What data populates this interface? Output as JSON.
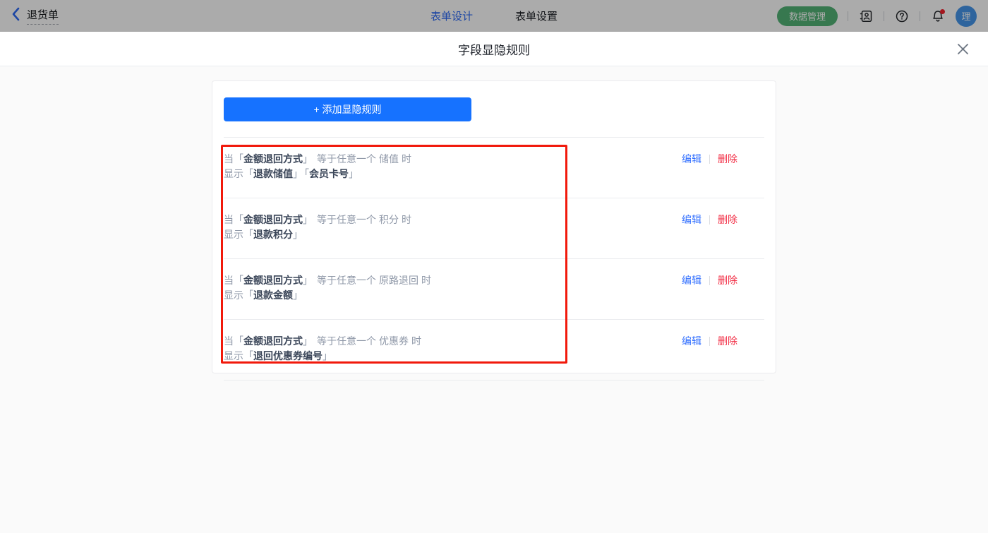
{
  "topbar": {
    "back_label": "退货单",
    "tabs": [
      {
        "label": "表单设计",
        "active": true
      },
      {
        "label": "表单设置",
        "active": false
      }
    ],
    "data_manage_label": "数据管理",
    "avatar_text": "理",
    "accent_blue": "#2e6bf5",
    "green_button_color": "#53b376"
  },
  "modal": {
    "title": "字段显隐规则",
    "add_rule_label": "+ 添加显隐规则",
    "button_color": "#1672ff",
    "annotation_color": "#f1190b",
    "punct": {
      "open": "「",
      "close": "」"
    },
    "actions": {
      "edit": "编辑",
      "delete": "删除"
    },
    "rules": [
      {
        "when": "当",
        "field": "金额退回方式",
        "operator": "等于任意一个",
        "value": "储值",
        "suffix": "时",
        "show": "显示",
        "targets": [
          "退款储值",
          "会员卡号"
        ]
      },
      {
        "when": "当",
        "field": "金额退回方式",
        "operator": "等于任意一个",
        "value": "积分",
        "suffix": "时",
        "show": "显示",
        "targets": [
          "退款积分"
        ]
      },
      {
        "when": "当",
        "field": "金额退回方式",
        "operator": "等于任意一个",
        "value": "原路退回",
        "suffix": "时",
        "show": "显示",
        "targets": [
          "退款金额"
        ]
      },
      {
        "when": "当",
        "field": "金额退回方式",
        "operator": "等于任意一个",
        "value": "优惠券",
        "suffix": "时",
        "show": "显示",
        "targets": [
          "退回优惠券编号"
        ]
      }
    ]
  }
}
